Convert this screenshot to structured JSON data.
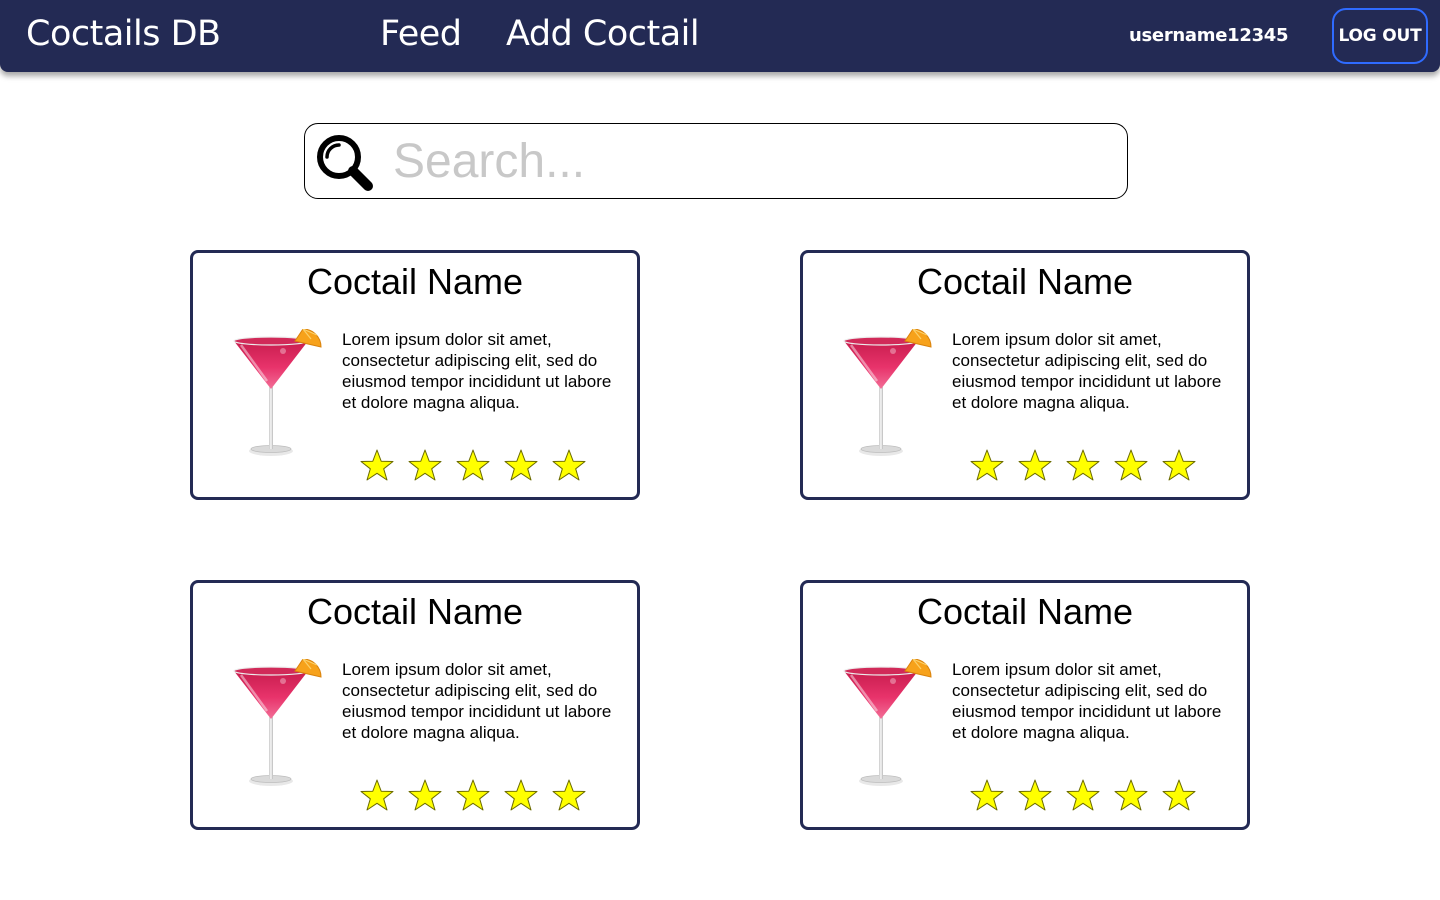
{
  "header": {
    "brand": "Coctails DB",
    "nav": [
      {
        "label": "Feed"
      },
      {
        "label": "Add Coctail"
      }
    ],
    "username": "username12345",
    "logout_label": "LOG OUT"
  },
  "search": {
    "placeholder": "Search...",
    "value": ""
  },
  "colors": {
    "navbar": "#232a54",
    "card_border": "#232a54",
    "logout_border": "#2f6bff",
    "star_fill": "#ffff00"
  },
  "cards": [
    {
      "title": "Coctail Name",
      "description": "Lorem ipsum dolor sit amet, consectetur adipiscing elit, sed do eiusmod tempor incididunt ut labore et dolore magna aliqua.",
      "rating": 5,
      "rating_max": 5
    },
    {
      "title": "Coctail Name",
      "description": "Lorem ipsum dolor sit amet, consectetur adipiscing elit, sed do eiusmod tempor incididunt ut labore et dolore magna aliqua.",
      "rating": 5,
      "rating_max": 5
    },
    {
      "title": "Coctail Name",
      "description": "Lorem ipsum dolor sit amet, consectetur adipiscing elit, sed do eiusmod tempor incididunt ut labore et dolore magna aliqua.",
      "rating": 5,
      "rating_max": 5
    },
    {
      "title": "Coctail Name",
      "description": "Lorem ipsum dolor sit amet, consectetur adipiscing elit, sed do eiusmod tempor incididunt ut labore et dolore magna aliqua.",
      "rating": 5,
      "rating_max": 5
    }
  ]
}
